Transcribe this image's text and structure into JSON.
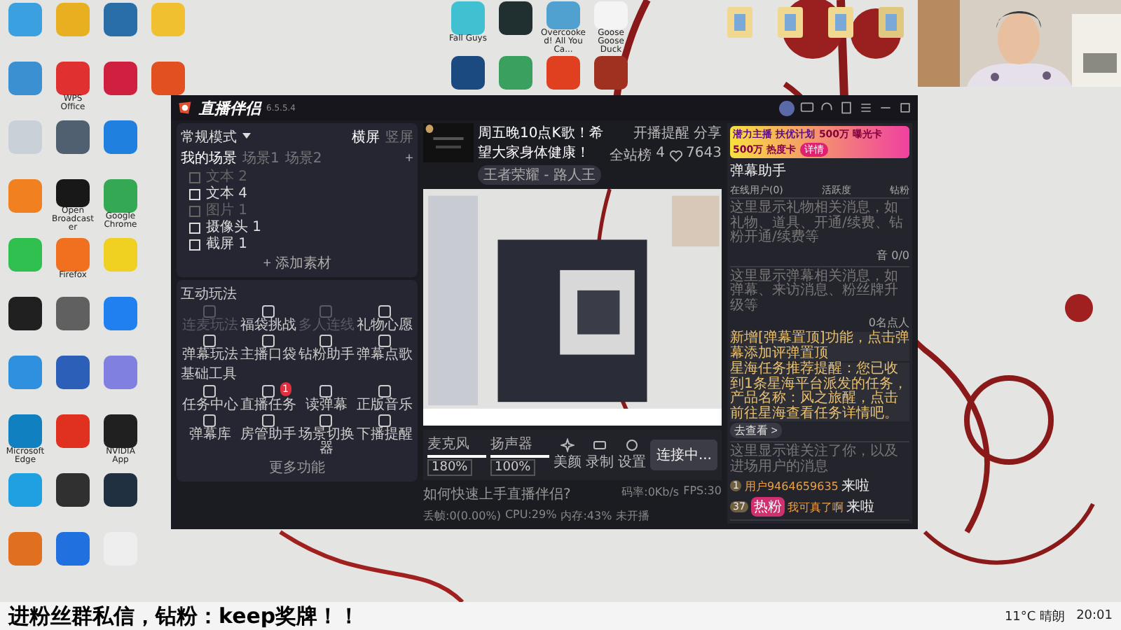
{
  "desktop": {
    "icon_rows": [
      [
        {
          "color": "#3aa0e0"
        },
        {
          "color": "#e8b020"
        },
        {
          "color": "#2a6ea8"
        },
        {
          "color": "#f0c030"
        }
      ],
      [
        {
          "color": "#3a90d0"
        },
        {
          "color": "#e03030",
          "label": "WPS Office"
        },
        {
          "color": "#d02040"
        },
        {
          "color": "#e05020"
        }
      ],
      [
        {
          "color": "#c8d0d8"
        },
        {
          "color": "#506070"
        },
        {
          "color": "#2080e0"
        }
      ],
      [
        {
          "color": "#f08020"
        },
        {
          "color": "#181818",
          "label": "Open Broadcaster"
        },
        {
          "color": "#34a853",
          "label": "Google Chrome"
        }
      ],
      [
        {
          "color": "#30c050"
        },
        {
          "color": "#f07020",
          "label": "Firefox"
        },
        {
          "color": "#f0d020"
        }
      ],
      [
        {
          "color": "#202020"
        },
        {
          "color": "#606060"
        },
        {
          "color": "#2080f0"
        }
      ],
      [
        {
          "color": "#3090e0"
        },
        {
          "color": "#2b5fb8"
        },
        {
          "color": "#8080e0"
        }
      ],
      [
        {
          "color": "#1080c0",
          "label": "Microsoft Edge"
        },
        {
          "color": "#e03020"
        },
        {
          "color": "#202020",
          "label": "NVIDIA App"
        }
      ],
      [
        {
          "color": "#20a0e0"
        },
        {
          "color": "#303030"
        },
        {
          "color": "#203040"
        }
      ],
      [
        {
          "color": "#e07020"
        },
        {
          "color": "#2070e0"
        },
        {
          "color": "#eeeeee"
        }
      ]
    ],
    "top_icon_rows": [
      [
        {
          "color": "#40c0d0",
          "label": "Fall Guys"
        },
        {
          "color": "#203030"
        },
        {
          "color": "#50a0d0",
          "label": "Overcooked! All You Ca..."
        },
        {
          "color": "#f4f4f4",
          "label": "Goose Goose Duck"
        }
      ],
      [
        {
          "color": "#1a4a80"
        },
        {
          "color": "#3aa060"
        },
        {
          "color": "#e04020"
        },
        {
          "color": "#a03020"
        }
      ]
    ],
    "folders": [
      {
        "color": "#f0d890"
      },
      {
        "color": "#f0d890"
      },
      {
        "color": "#f0d890"
      },
      {
        "color": "#e0c880"
      }
    ]
  },
  "app": {
    "name": "直播伴侣",
    "version": "6.5.5.4",
    "mode": {
      "label": "常规模式",
      "orientations": [
        {
          "label": "横屏",
          "selected": true
        },
        {
          "label": "竖屏",
          "selected": false
        }
      ]
    },
    "scene_tabs": [
      {
        "label": "我的场景",
        "selected": true
      },
      {
        "label": "场景1",
        "selected": false
      },
      {
        "label": "场景2",
        "selected": false
      }
    ],
    "add_scene": "+",
    "sources": [
      {
        "name": "文本 2",
        "visible": false
      },
      {
        "name": "文本 4",
        "visible": true
      },
      {
        "name": "图片 1",
        "visible": false
      },
      {
        "name": "摄像头 1",
        "visible": true
      },
      {
        "name": "截屏 1",
        "visible": true
      }
    ],
    "add_source": "+ 添加素材",
    "interactive": {
      "title": "互动玩法",
      "items": [
        {
          "label": "连麦玩法",
          "disabled": true
        },
        {
          "label": "福袋挑战",
          "disabled": false
        },
        {
          "label": "多人连线",
          "disabled": true
        },
        {
          "label": "礼物心愿",
          "disabled": false
        },
        {
          "label": "弹幕玩法",
          "disabled": false
        },
        {
          "label": "主播口袋",
          "disabled": false
        },
        {
          "label": "钻粉助手",
          "disabled": false
        },
        {
          "label": "弹幕点歌",
          "disabled": false
        }
      ]
    },
    "tools": {
      "title": "基础工具",
      "items": [
        {
          "label": "任务中心"
        },
        {
          "label": "直播任务",
          "badge": "1"
        },
        {
          "label": "读弹幕"
        },
        {
          "label": "正版音乐"
        },
        {
          "label": "弹幕库"
        },
        {
          "label": "房管助手"
        },
        {
          "label": "场景切换器"
        },
        {
          "label": "下播提醒"
        }
      ],
      "more": "更多功能"
    },
    "stream": {
      "title": "周五晚10点K歌！希望大家身体健康！",
      "category": "王者荣耀 - 路人王",
      "remind": "开播提醒",
      "share": "分享",
      "rank": "全站榜",
      "likes": "4",
      "hearts": "7643"
    },
    "audio": [
      {
        "label": "麦克风",
        "level": 1,
        "reading": "180%"
      },
      {
        "label": "扬声器",
        "level": 1,
        "reading": "100%"
      }
    ],
    "actions": [
      {
        "label": "美颜",
        "kind": "beauty"
      },
      {
        "label": "录制",
        "kind": "record"
      },
      {
        "label": "设置",
        "kind": "settings"
      }
    ],
    "connect": "连接中...",
    "help": "如何快速上手直播伴侣?",
    "stats": [
      "码率:0Kb/s",
      "FPS:30",
      "丢帧:0(0.00%)",
      "CPU:29%",
      "内存:43%",
      "未开播"
    ],
    "banner": {
      "title": "潜力主播 扶优计划",
      "cards": [
        "500万 曝光卡",
        "500万 热度卡"
      ],
      "button": "详情"
    },
    "danmu": {
      "title": "弹幕助手",
      "tabs": [
        {
          "label": "在线用户(0)",
          "selected": false
        },
        {
          "label": "活跃度",
          "selected": false
        },
        {
          "label": "钻粉",
          "selected": false
        }
      ],
      "gift_hint": "这里显示礼物相关消息，如礼物、道具、开通/续费、钻粉开通/续费等",
      "gift_count": "音 0/0",
      "chat_hint": "这里显示弹幕相关消息，如弹幕、来访消息、粉丝牌升级等",
      "chat_count": "0名点人",
      "notices": [
        "新增[弹幕置顶]功能，点击弹幕添加评弹置顶",
        "星海任务推荐提醒：您已收到1条星海平台派发的任务，产品名称：风之旅醒，点击前往星海查看任务详情吧。"
      ],
      "notice_link": "去查看 >",
      "follow_hint": "这里显示谁关注了你，以及进场用户的消息",
      "visitors": [
        {
          "level": "1",
          "name": "用户9464659635",
          "action": "来啦"
        },
        {
          "level": "37",
          "fan": "热粉",
          "name": "我可真了啊",
          "action": "来啦"
        }
      ]
    }
  },
  "caption": "进粉丝群私信，钻粉：keep奖牌！！",
  "tray": {
    "weather": "11°C 晴朗",
    "time": "20:01"
  }
}
